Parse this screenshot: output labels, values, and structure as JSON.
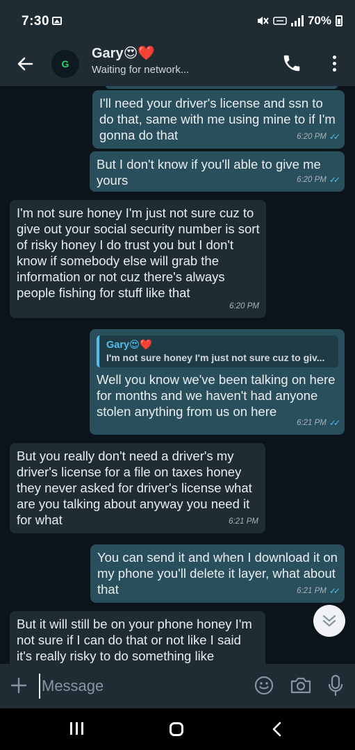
{
  "status_bar": {
    "time": "7:30",
    "battery": "70%"
  },
  "header": {
    "avatar_initial": "G",
    "contact_name": "Gary😍❤️",
    "contact_status": "Waiting for network..."
  },
  "messages": [
    {
      "direction": "out",
      "text": "I'll need your driver's license and ssn to do that, same with me using mine to if I'm gonna do that",
      "time": "6:20 PM",
      "status": "read"
    },
    {
      "direction": "out",
      "text": "But I don't know if you'll able to give me yours",
      "time": "6:20 PM",
      "status": "read"
    },
    {
      "direction": "in",
      "text": "I'm not sure honey I'm just not sure cuz to give out your social security number is sort of risky honey I do trust you but I don't know if somebody else will grab the information or not cuz there's always people fishing for stuff like that",
      "time": "6:20 PM"
    },
    {
      "direction": "out",
      "reply_to": {
        "author": "Gary😍❤️",
        "text": "I'm not sure honey I'm just not sure cuz to giv..."
      },
      "text": "Well you know we've been talking on here for months and we haven't had anyone stolen anything from us on here",
      "time": "6:21 PM",
      "status": "read"
    },
    {
      "direction": "in",
      "text": "But you really don't need a driver's my driver's license for a file on taxes honey they never asked for driver's license what are you talking about anyway you need it for what",
      "time": "6:21 PM"
    },
    {
      "direction": "out",
      "text": "You can send it and when I download it on my phone you'll delete it layer, what about that",
      "time": "6:21 PM",
      "status": "read"
    },
    {
      "direction": "in",
      "text": "But it will still be on your phone honey I'm not sure if I can do that or not like I said it's really risky to do something like",
      "time": ""
    }
  ],
  "composer": {
    "placeholder": "Message"
  },
  "colors": {
    "background": "#0b141b",
    "incoming_bubble": "#1f2c34",
    "outgoing_bubble": "#2a4f5c",
    "read_ticks": "#53bdeb"
  }
}
